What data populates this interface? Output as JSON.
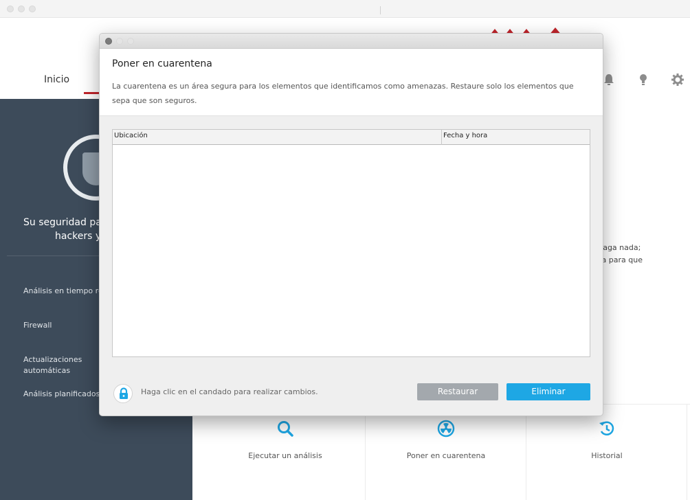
{
  "background": {
    "nav": {
      "home_label": "Inicio"
    },
    "sidebar": {
      "headline_line1": "Su seguridad pa",
      "headline_line2": "hackers y",
      "items": [
        {
          "label": "Análisis en tiempo re"
        },
        {
          "label": "Firewall"
        },
        {
          "label": "Actualizaciones"
        },
        {
          "label": "automáticas"
        },
        {
          "label": "Análisis planificados"
        }
      ]
    },
    "status_text": {
      "line1": "o haga nada;",
      "line2": "iosa para que"
    },
    "tiles": [
      {
        "label": "Ejecutar un análisis",
        "icon": "search-icon"
      },
      {
        "label": "Poner en cuarentena",
        "icon": "radiation-icon"
      },
      {
        "label": "Historial",
        "icon": "history-icon"
      }
    ]
  },
  "dialog": {
    "title": "Poner en cuarentena",
    "description": "La cuarentena es un área segura para los elementos que identificamos como amenazas. Restaure solo los elementos que sepa que son seguros.",
    "table": {
      "columns": [
        "Ubicación",
        "Fecha y hora"
      ],
      "rows": []
    },
    "lock_hint": "Haga clic en el candado para realizar cambios.",
    "restore_label": "Restaurar",
    "delete_label": "Eliminar"
  },
  "colors": {
    "accent_blue": "#1ea7e4",
    "brand_red": "#c0242b",
    "sidebar_bg": "#3d4b5a",
    "disabled_button": "#a3a8ad"
  }
}
